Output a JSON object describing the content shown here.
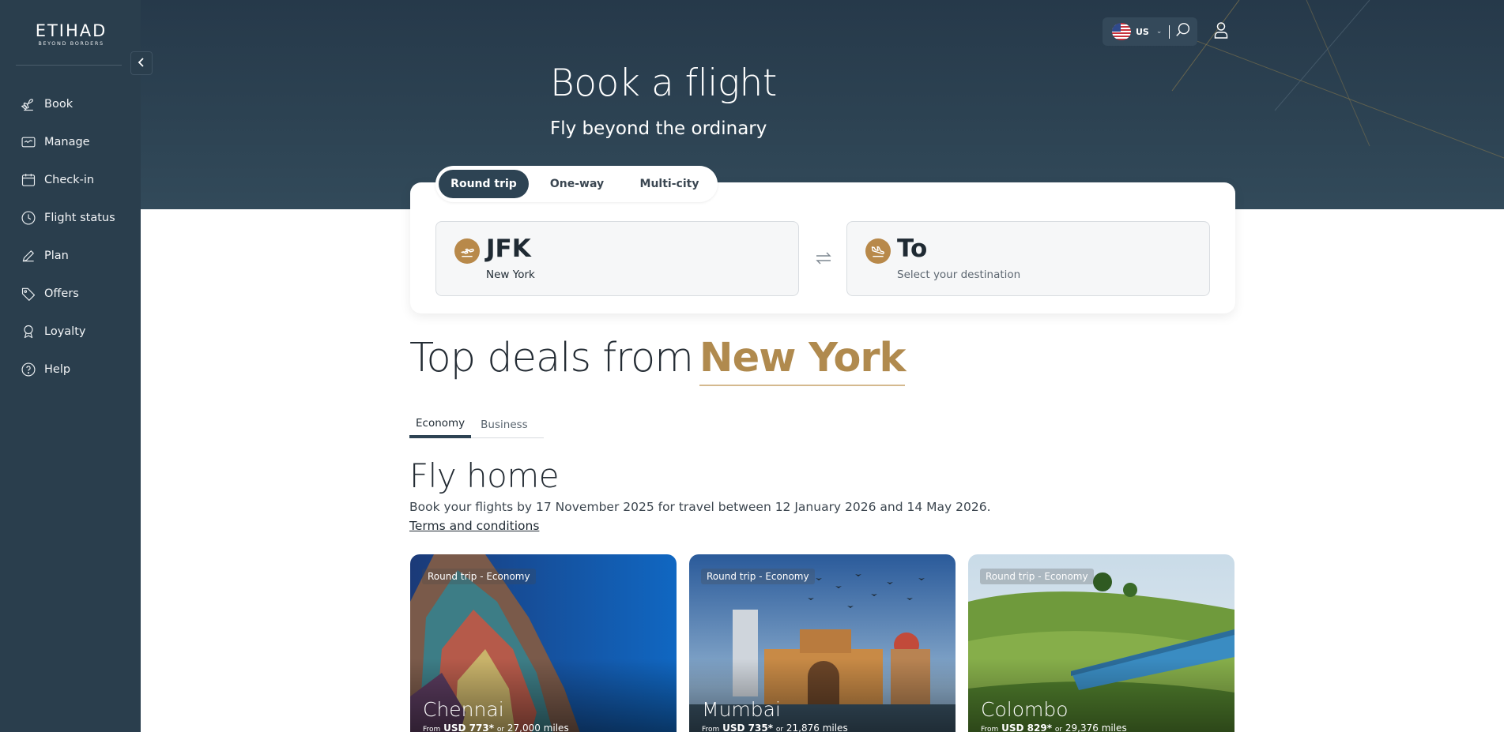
{
  "brand": {
    "name": "ETIHAD",
    "tagline": "BEYOND BORDERS"
  },
  "sidebar": {
    "items": [
      {
        "label": "Book",
        "icon": "plane-icon"
      },
      {
        "label": "Manage",
        "icon": "ticket-icon"
      },
      {
        "label": "Check-in",
        "icon": "calendar-icon"
      },
      {
        "label": "Flight status",
        "icon": "clock-icon"
      },
      {
        "label": "Plan",
        "icon": "pen-icon"
      },
      {
        "label": "Offers",
        "icon": "tag-icon"
      },
      {
        "label": "Loyalty",
        "icon": "award-icon"
      },
      {
        "label": "Help",
        "icon": "help-icon"
      }
    ]
  },
  "header": {
    "region_code": "US"
  },
  "hero": {
    "title": "Book a flight",
    "subtitle": "Fly beyond the ordinary"
  },
  "booking": {
    "trip_types": [
      "Round trip",
      "One-way",
      "Multi-city"
    ],
    "selected_trip": "Round trip",
    "from": {
      "code": "JFK",
      "city": "New York"
    },
    "to": {
      "label": "To",
      "placeholder": "Select your destination"
    }
  },
  "deals": {
    "title_prefix": "Top deals from",
    "city": "New York",
    "cabin_tabs": [
      "Economy",
      "Business"
    ],
    "selected_cabin": "Economy",
    "promo_title": "Fly home",
    "promo_desc": "Book your flights by 17 November 2025 for travel between 12 January 2026 and 14 May 2026.",
    "terms_link": "Terms and conditions",
    "cards": [
      {
        "badge": "Round trip - Economy",
        "city": "Chennai",
        "from": "From",
        "price": "USD 773*",
        "or": "or",
        "miles": "27,000",
        "miles_label": "miles"
      },
      {
        "badge": "Round trip - Economy",
        "city": "Mumbai",
        "from": "From",
        "price": "USD 735*",
        "or": "or",
        "miles": "21,876",
        "miles_label": "miles"
      },
      {
        "badge": "Round trip - Economy",
        "city": "Colombo",
        "from": "From",
        "price": "USD 829*",
        "or": "or",
        "miles": "29,376",
        "miles_label": "miles"
      }
    ]
  },
  "colors": {
    "sidebar": "#2a3e4d",
    "hero": "#2d4353",
    "accent_gold": "#b08a4e",
    "icon_gold": "#b8894a"
  }
}
